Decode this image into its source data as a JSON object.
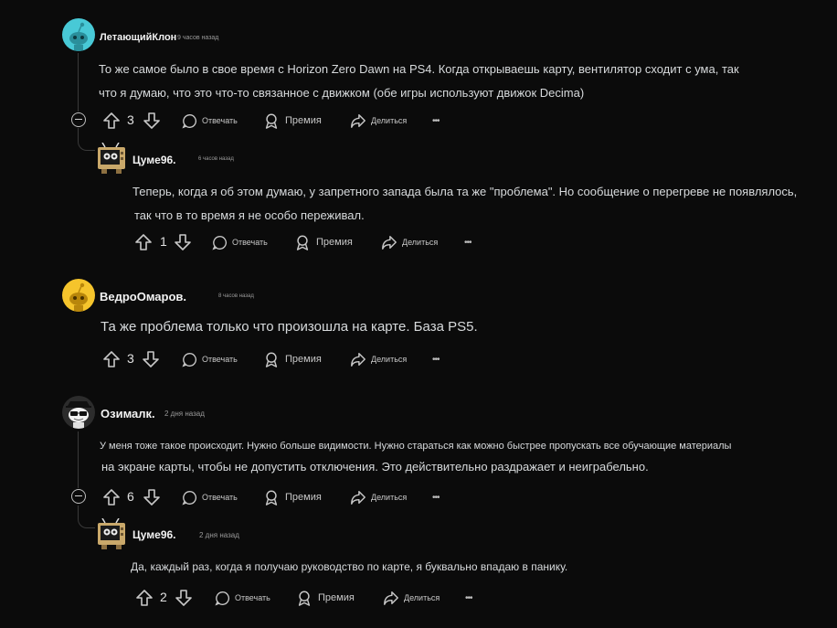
{
  "labels": {
    "reply": "Отвечать",
    "award": "Премия",
    "share": "Делиться",
    "more": "•••"
  },
  "comments": [
    {
      "username": "ЛетающийКлон",
      "time": "9 часов назад",
      "avatar_icon": "reddit-snoo-teal-avatar",
      "text_lines": [
        "То же самое было в свое время с Horizon Zero Dawn на PS4. Когда открываешь карту, вентилятор сходит с ума, так",
        "что я думаю, что это что-то связанное с движком (обе игры используют движок Decima)"
      ],
      "votes": "3"
    },
    {
      "username": "Цуме96.",
      "time": "6 часов назад",
      "avatar_icon": "tv-robot-avatar",
      "text_lines": [
        "Теперь, когда я об этом думаю, у запретного запада была та же \"проблема\". Но сообщение о перегреве не появлялось,",
        "так что в то время я не особо переживал."
      ],
      "votes": "1"
    },
    {
      "username": "ВедроОмаров.",
      "time": "8 часов назад",
      "avatar_icon": "reddit-snoo-yellow-avatar",
      "text_lines": [
        "Та же проблема только что произошла на карте. База PS5."
      ],
      "votes": "3"
    },
    {
      "username": "Озималк.",
      "time": "2 дня назад",
      "avatar_icon": "snoo-sunglasses-avatar",
      "text_lines": [
        "У меня тоже такое происходит. Нужно больше видимости. Нужно стараться как можно быстрее пропускать все обучающие материалы",
        "на экране карты, чтобы не допустить отключения. Это действительно раздражает и неиграбельно."
      ],
      "votes": "6"
    },
    {
      "username": "Цуме96.",
      "time": "2 дня назад",
      "avatar_icon": "tv-robot-avatar",
      "text_lines": [
        "Да, каждый раз, когда я получаю руководство по карте, я буквально впадаю в панику."
      ],
      "votes": "2"
    }
  ],
  "colors": {
    "background": "#0b0b0b",
    "text": "#d7dadc",
    "thread_line": "#3a3a3a",
    "teal_avatar": "#48c9d6",
    "yellow_avatar": "#f5c42c"
  }
}
